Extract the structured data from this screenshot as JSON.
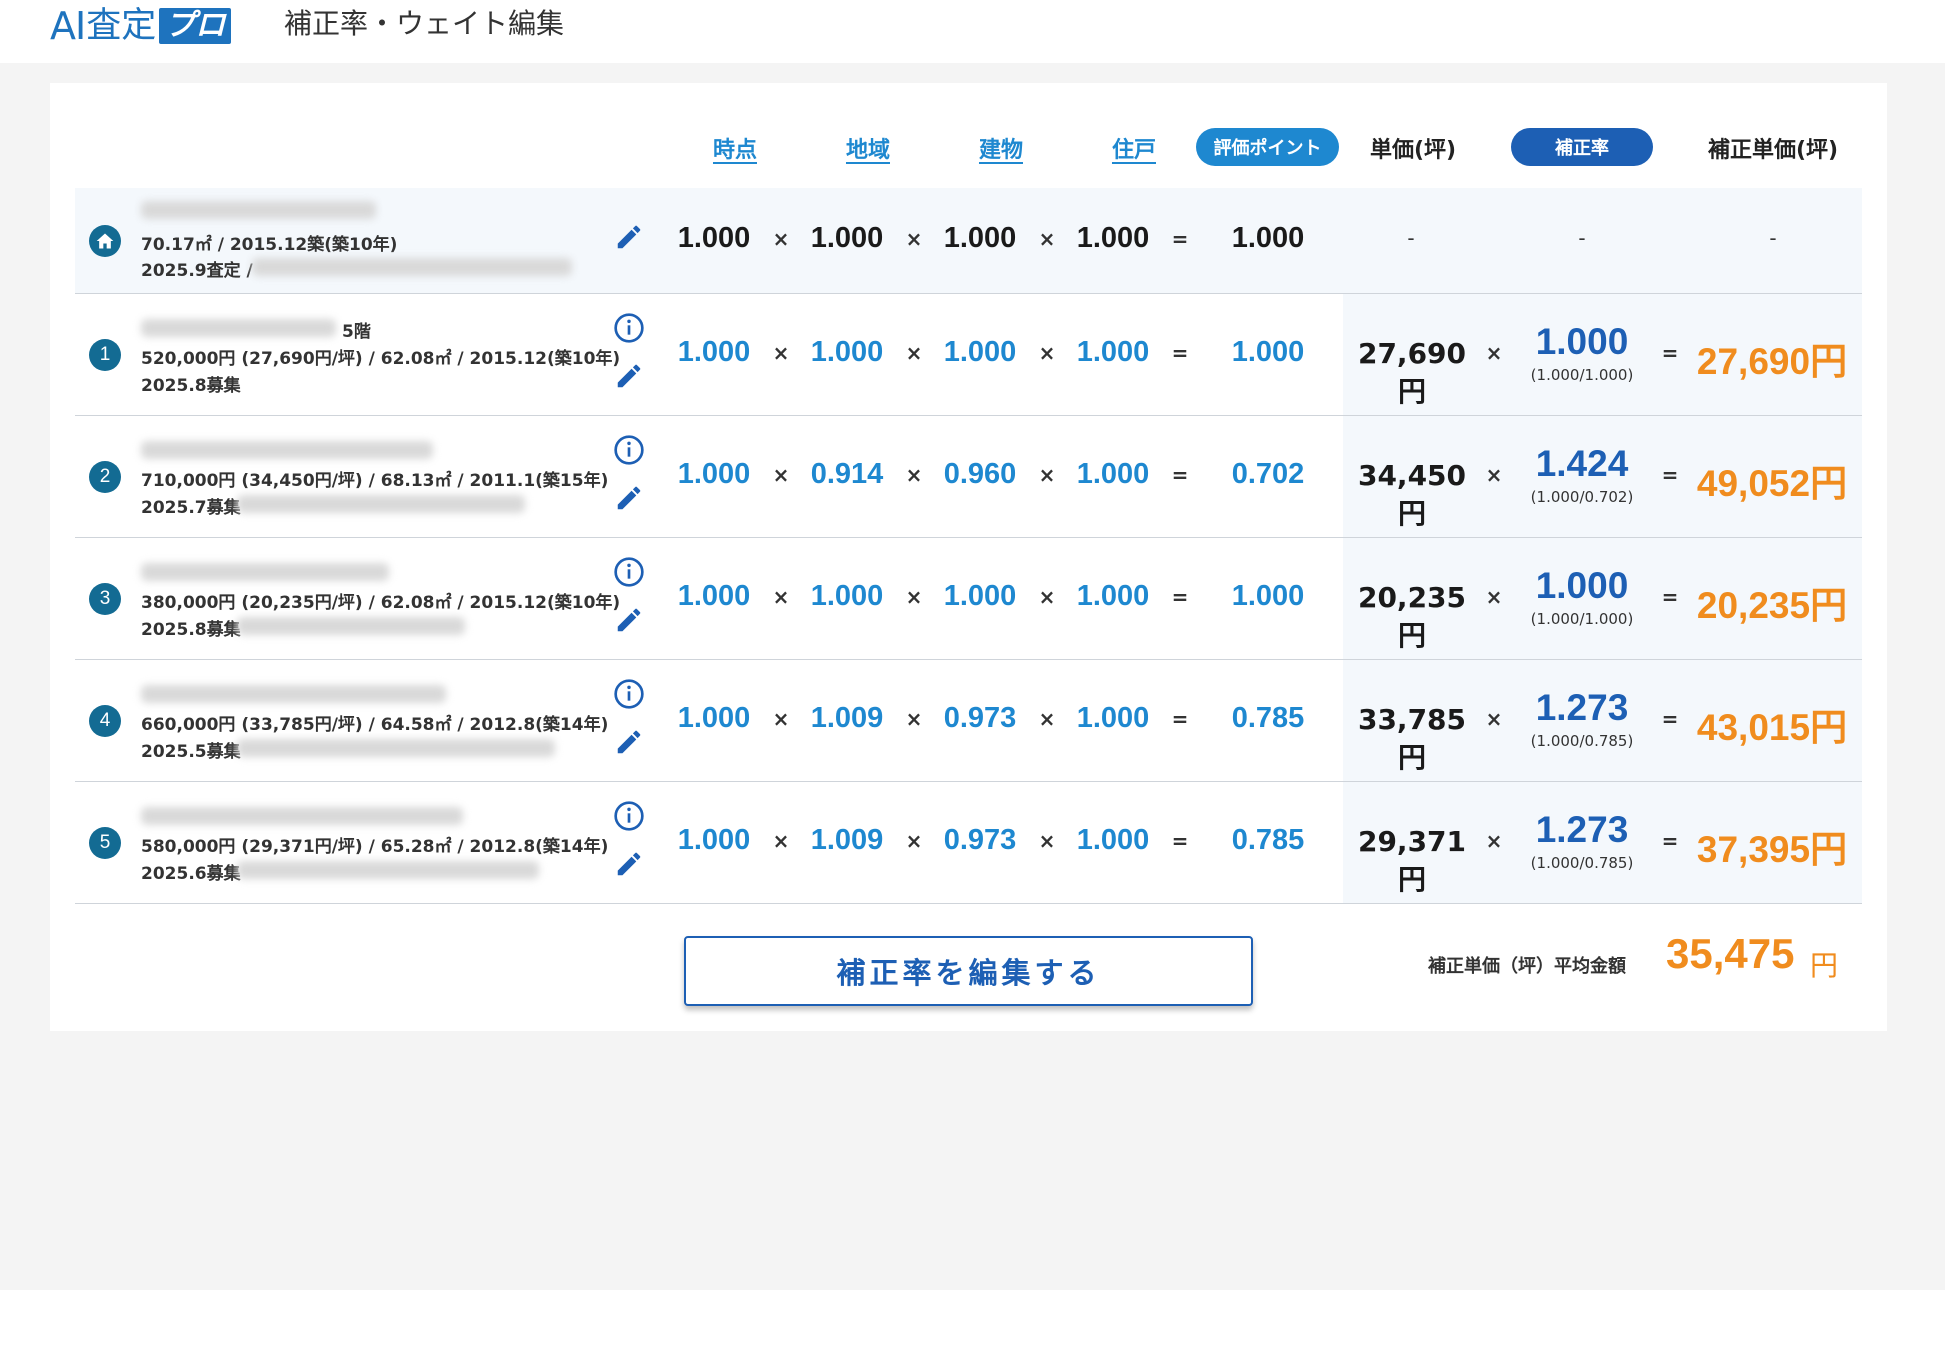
{
  "app": {
    "logo_ai": "AI",
    "logo_satei": "査定",
    "logo_pro": "プロ",
    "page_title": "補正率・ウェイト編集"
  },
  "headers": {
    "jiten": "時点",
    "chiiki": "地域",
    "tatemono": "建物",
    "juko": "住戸",
    "eval_point": "評価ポイント",
    "unit_price": "単価(坪)",
    "correction_rate": "補正率",
    "corrected_unit_price": "補正単価(坪)"
  },
  "symbols": {
    "times": "×",
    "equals": "=",
    "dash": "-"
  },
  "subject": {
    "line1": "70.17㎡ / 2015.12築(築10年)",
    "line2": "2025.9査定 /",
    "values": [
      "1.000",
      "1.000",
      "1.000",
      "1.000"
    ],
    "point": "1.000"
  },
  "rows": [
    {
      "badge": "1",
      "line0": "5階",
      "line1": "520,000円 (27,690円/坪) / 62.08㎡ / 2015.12(築10年)",
      "line2": "2025.8募集",
      "values": [
        "1.000",
        "1.000",
        "1.000",
        "1.000"
      ],
      "point": "1.000",
      "unit_price": "27,690円",
      "rate": "1.000",
      "rate_sub": "(1.000/1.000)",
      "result": "27,690円"
    },
    {
      "badge": "2",
      "line0": "",
      "line1": "710,000円 (34,450円/坪) / 68.13㎡ / 2011.1(築15年)",
      "line2": "2025.7募集",
      "values": [
        "1.000",
        "0.914",
        "0.960",
        "1.000"
      ],
      "point": "0.702",
      "unit_price": "34,450円",
      "rate": "1.424",
      "rate_sub": "(1.000/0.702)",
      "result": "49,052円"
    },
    {
      "badge": "3",
      "line0": "",
      "line1": "380,000円 (20,235円/坪) / 62.08㎡ / 2015.12(築10年)",
      "line2": "2025.8募集",
      "values": [
        "1.000",
        "1.000",
        "1.000",
        "1.000"
      ],
      "point": "1.000",
      "unit_price": "20,235円",
      "rate": "1.000",
      "rate_sub": "(1.000/1.000)",
      "result": "20,235円"
    },
    {
      "badge": "4",
      "line0": "",
      "line1": "660,000円 (33,785円/坪) / 64.58㎡ / 2012.8(築14年)",
      "line2": "2025.5募集",
      "values": [
        "1.000",
        "1.009",
        "0.973",
        "1.000"
      ],
      "point": "0.785",
      "unit_price": "33,785円",
      "rate": "1.273",
      "rate_sub": "(1.000/0.785)",
      "result": "43,015円"
    },
    {
      "badge": "5",
      "line0": "",
      "line1": "580,000円 (29,371円/坪) / 65.28㎡ / 2012.8(築14年)",
      "line2": "2025.6募集",
      "values": [
        "1.000",
        "1.009",
        "0.973",
        "1.000"
      ],
      "point": "0.785",
      "unit_price": "29,371円",
      "rate": "1.273",
      "rate_sub": "(1.000/0.785)",
      "result": "37,395円"
    }
  ],
  "footer": {
    "edit_button": "補正率を編集する",
    "avg_label": "補正単価（坪）平均金額",
    "avg_value": "35,475",
    "avg_unit": "円"
  },
  "colors": {
    "brand_blue": "#1e73be",
    "link_blue": "#1e88d0",
    "dark_blue": "#1d5fb4",
    "orange": "#f08c1e",
    "badge_teal": "#136b93"
  }
}
